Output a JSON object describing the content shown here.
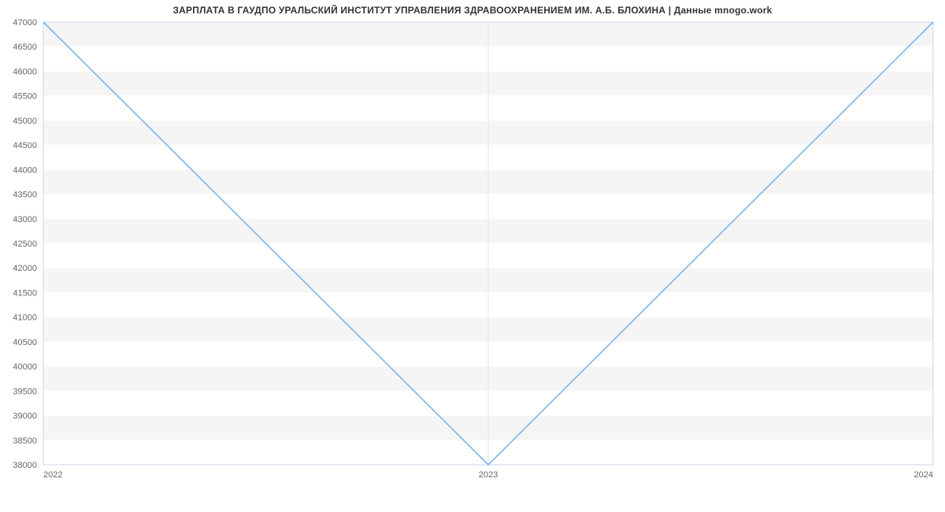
{
  "chart_data": {
    "type": "line",
    "title": "ЗАРПЛАТА В ГАУДПО УРАЛЬСКИЙ ИНСТИТУТ УПРАВЛЕНИЯ ЗДРАВООХРАНЕНИЕМ ИМ. А.Б. БЛОХИНА | Данные mnogo.work",
    "x": [
      2022,
      2023,
      2024
    ],
    "values": [
      47000,
      38000,
      47000
    ],
    "x_ticks": [
      2022,
      2023,
      2024
    ],
    "y_ticks": [
      38000,
      38500,
      39000,
      39500,
      40000,
      40500,
      41000,
      41500,
      42000,
      42500,
      43000,
      43500,
      44000,
      44500,
      45000,
      45500,
      46000,
      46500,
      47000
    ],
    "ylim": [
      38000,
      47000
    ],
    "xlabel": "",
    "ylabel": ""
  }
}
